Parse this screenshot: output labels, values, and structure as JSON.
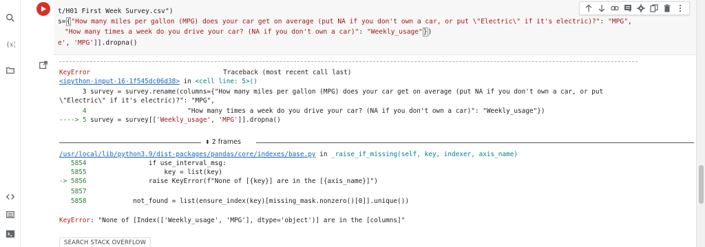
{
  "rail": {
    "icons": [
      "search-icon",
      "variables-icon",
      "files-icon",
      "code-snippets-icon",
      "command-palette-icon",
      "terminal-icon"
    ]
  },
  "cell": {
    "code_lines": [
      {
        "plain": "t/H01 First Week Survey.csv\")"
      },
      {
        "prefix": "s=",
        "brace": "{",
        "str1": "\"How many miles per gallon (MPG) does your car get on average (put NA if you don't own a car, or put \\\"Electric\\\" if it's electric)?\"",
        "colon": ": ",
        "str2": "\"MPG\"",
        "tail": ","
      },
      {
        "str1": "\"How many times a week do you drive your car? (NA if you don't own a car)\"",
        "colon": ": ",
        "str2": "\"Weekly_usage\"",
        "brace": "}",
        "tail": ")"
      },
      {
        "str1": "e'",
        "mid": ", ",
        "str2": "'MPG'",
        "tail": "]].dropna()"
      }
    ],
    "toolbar_icons": [
      "arrow-up-icon",
      "arrow-down-icon",
      "link-icon",
      "comment-icon",
      "settings-icon",
      "mirror-cell-icon",
      "delete-icon",
      "more-options-icon"
    ]
  },
  "output": {
    "error_name": "KeyError",
    "traceback_label": "Traceback (most recent call last)",
    "input_link": "<ipython-input-16-1f545dc06d38>",
    "in_word": " in ",
    "cell_line": "<cell line: 5>()",
    "ctx1": "      3 survey = survey.rename(columns={\"How many miles per gallon (MPG) does your car get on average (put NA if you don't own a car, or put",
    "ctx2": "\\\"Electric\\\" if it's electric)?\": \"MPG\",",
    "ctx3_num": "      4",
    "ctx3_text": "                          \"How many times a week do you drive your car? (NA if you don't own a car)\": \"Weekly_usage\"})",
    "ctx4_arrow": "----> 5 ",
    "ctx4_a": "survey = survey[[",
    "ctx4_b": "'Weekly_usage'",
    "ctx4_c": ", ",
    "ctx4_d": "'MPG'",
    "ctx4_e": "]].dropna()",
    "frames_label": "2 frames",
    "path_link": "/usr/local/lib/python3.9/dist-packages/pandas/core/indexes/base.py",
    "path_in": " in ",
    "func_sig": "_raise_if_missing(self, key, indexer, axis_name)",
    "src_lines": [
      {
        "num": "   5854",
        "text": "                if use_interval_msg:"
      },
      {
        "num": "   5855",
        "text": "                    key = list(key)"
      },
      {
        "num": "-> 5856",
        "text": "                raise KeyError(f\"None of [{key}] are in the [{axis_name}]\")"
      },
      {
        "num": "   5857",
        "text": ""
      },
      {
        "num": "   5858",
        "text": "            not_found = list(ensure_index(key)[missing_mask.nonzero()[0]].unique())"
      }
    ],
    "final_error": "KeyError",
    "final_msg": ": \"None of [Index(['Weekly_usage', 'MPG'], dtype='object')] are in the [columns]\"",
    "so_button": "SEARCH STACK OVERFLOW"
  },
  "colors": {
    "run_button": "#d93025",
    "error_red": "#b71c1c",
    "link_blue": "#1565c0",
    "string_red": "#a31515",
    "line_green": "#2e7d32"
  }
}
